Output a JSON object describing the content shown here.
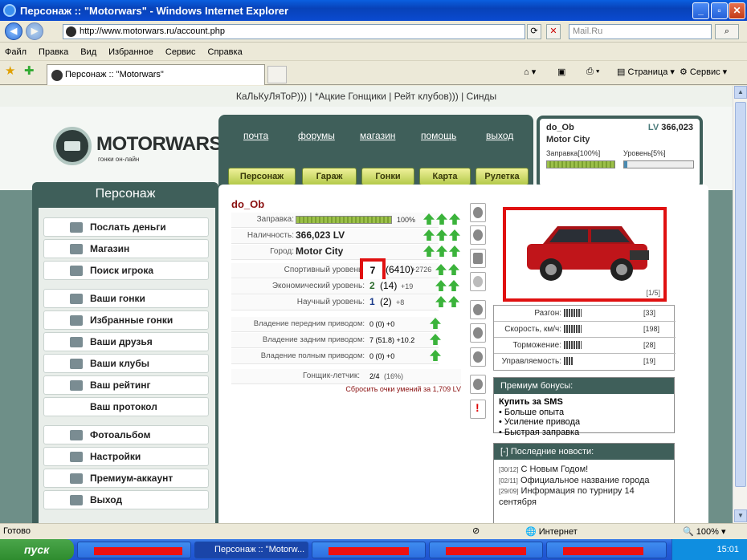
{
  "window": {
    "title": "Персонаж :: \"Motorwars\" - Windows Internet Explorer"
  },
  "browser": {
    "url": "http://www.motorwars.ru/account.php",
    "search_placeholder": "Mail.Ru",
    "menu": [
      "Файл",
      "Правка",
      "Вид",
      "Избранное",
      "Сервис",
      "Справка"
    ],
    "tab_title": "Персонаж :: \"Motorwars\"",
    "toolbar_page": "Страница",
    "toolbar_service": "Сервис"
  },
  "site": {
    "top_links": "КаЛьКуЛяТоР))) | *Ацкие Гонщики | Рейт клубов))) | Синды",
    "logo_title": "MOTORWARS.RU",
    "logo_sub": "гонки он-лайн",
    "nav": [
      "почта",
      "форумы",
      "магазин",
      "помощь",
      "выход"
    ],
    "buttons": [
      "Персонаж",
      "Гараж",
      "Гонки",
      "Карта",
      "Рулетка"
    ],
    "user": {
      "name": "do_Ob",
      "lv_prefix": "LV",
      "lv_value": "366,023",
      "city": "Motor City",
      "fuel_label": "Заправка[100%]",
      "fuel": 1.0,
      "level_label": "Уровень[5%]",
      "level": 0.05
    }
  },
  "sidebar": {
    "title": "Персонаж",
    "items": [
      "Послать деньги",
      "Магазин",
      "Поиск игрока",
      "Ваши гонки",
      "Избранные гонки",
      "Ваши друзья",
      "Ваши клубы",
      "Ваш рейтинг",
      "Ваш протокол",
      "Фотоальбом",
      "Настройки",
      "Премиум-аккаунт",
      "Выход"
    ]
  },
  "character": {
    "name": "do_Ob",
    "fuel_label": "Заправка:",
    "fuel_pct": "100%",
    "money_label": "Наличность:",
    "money": "366,023 LV",
    "city_label": "Город:",
    "city": "Motor City",
    "sport_label": "Спортивный уровень:",
    "sport_value": "7",
    "sport_sub": "(6410)",
    "sport_plus": "+2726",
    "eco_label": "Экономический уровень:",
    "eco_value": "2",
    "eco_sub": "(14)",
    "eco_plus": "+19",
    "sci_label": "Научный уровень:",
    "sci_value": "1",
    "sci_sub": "(2)",
    "sci_plus": "+8",
    "fwd_label": "Владение передним приводом:",
    "fwd_value": "0 (0) +0",
    "rwd_label": "Владение задним приводом:",
    "rwd_value": "7 (51.8) +10.2",
    "awd_label": "Владение полным приводом:",
    "awd_value": "0 (0) +0",
    "flyer_label": "Гонщик-летчик:",
    "flyer_value": "2/4",
    "flyer_pct": "(16%)",
    "reset_link": "Сбросить очки умений за 1,709 LV"
  },
  "car": {
    "pager": "[1/5]",
    "stats": [
      {
        "label": "Разгон:",
        "value": "[33]"
      },
      {
        "label": "Скорость, км/ч:",
        "value": "[198]"
      },
      {
        "label": "Торможение:",
        "value": "[28]"
      },
      {
        "label": "Управляемость:",
        "value": "[19]"
      }
    ]
  },
  "premium": {
    "title": "Премиум бонусы:",
    "buy": "Купить за SMS",
    "items": [
      "Больше опыта",
      "Усиление привода",
      "Быстрая заправка"
    ]
  },
  "news": {
    "title": "[-]  Последние новости:",
    "items": [
      {
        "date": "[30/12]",
        "text": "С Новым Годом!"
      },
      {
        "date": "[02/11]",
        "text": "Официальное название города"
      },
      {
        "date": "[29/09]",
        "text": "Информация по турниру 14 сентября"
      }
    ]
  },
  "statusbar": {
    "left": "Готово",
    "zone": "Интернет",
    "zoom": "100%"
  },
  "taskbar": {
    "start": "пуск",
    "task": "Персонаж :: \"Motorw...",
    "time": "15:01"
  }
}
